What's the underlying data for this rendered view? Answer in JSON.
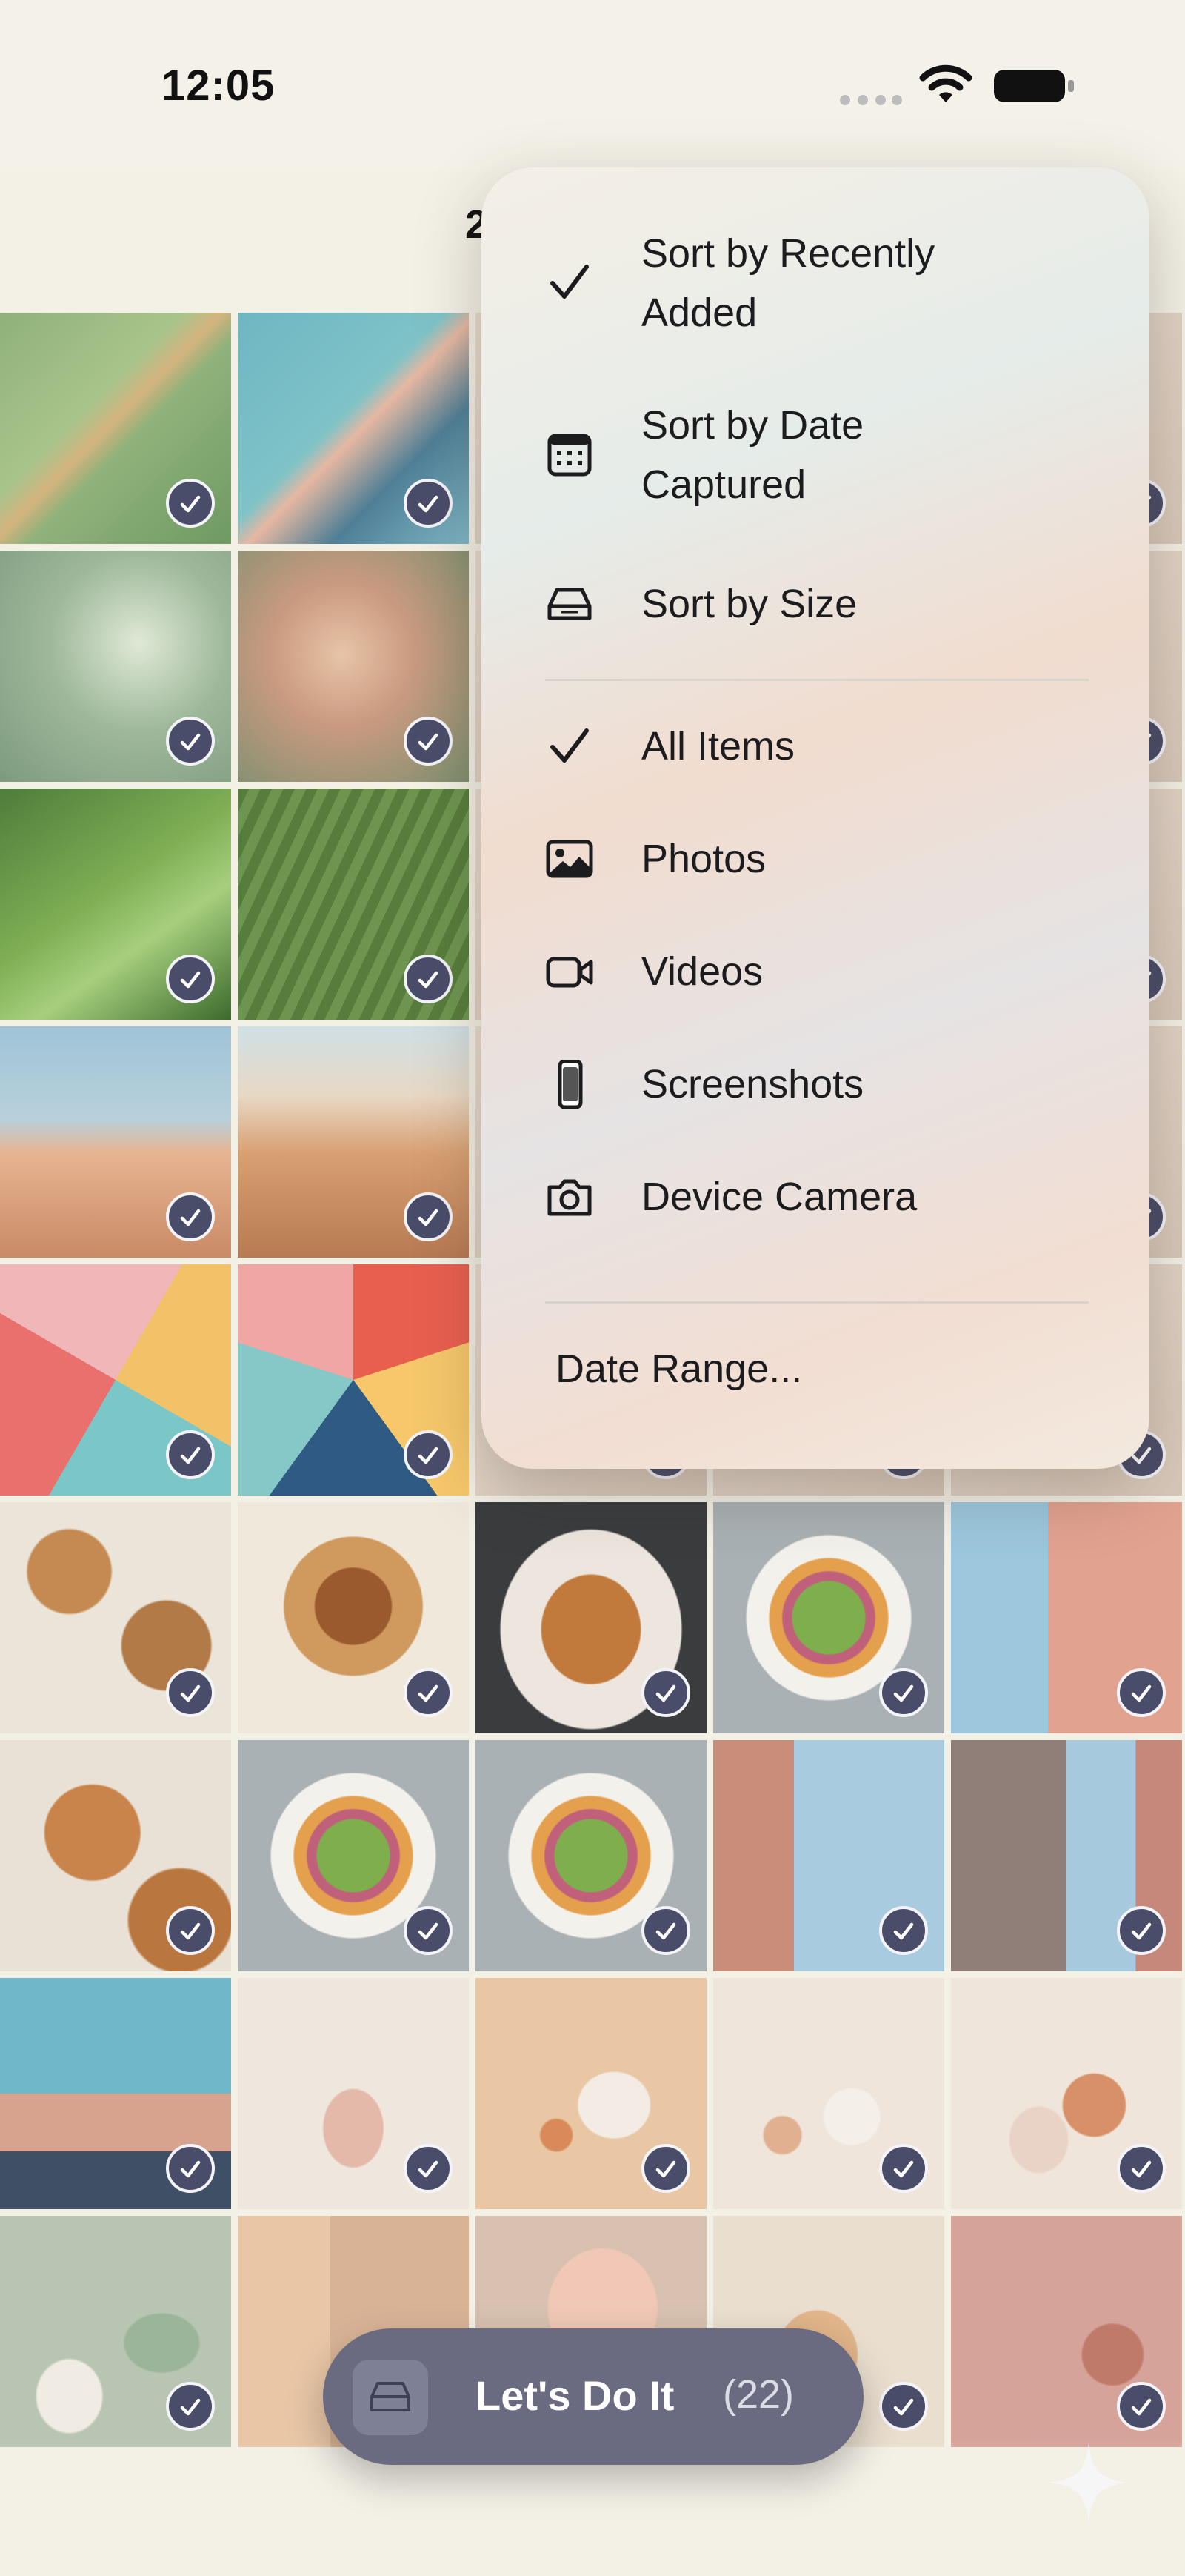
{
  "status_bar": {
    "time": "12:05"
  },
  "header": {
    "count_partial": "2"
  },
  "menu": {
    "sort_options": [
      {
        "label": "Sort by Recently Added",
        "icon": "checkmark-icon",
        "selected": true
      },
      {
        "label": "Sort by Date Captured",
        "icon": "calendar-icon",
        "selected": false
      },
      {
        "label": "Sort by Size",
        "icon": "disk-icon",
        "selected": false
      }
    ],
    "filter_options": [
      {
        "label": "All Items",
        "icon": "checkmark-icon",
        "selected": true
      },
      {
        "label": "Photos",
        "icon": "photo-icon",
        "selected": false
      },
      {
        "label": "Videos",
        "icon": "video-icon",
        "selected": false
      },
      {
        "label": "Screenshots",
        "icon": "phone-icon",
        "selected": false
      },
      {
        "label": "Device Camera",
        "icon": "camera-icon",
        "selected": false
      }
    ],
    "date_range_label": "Date Range..."
  },
  "grid": {
    "rows": 9,
    "cols": 5,
    "all_selected": true,
    "photos": [
      [
        "aerial-fields",
        "coastline-aerial",
        "",
        "",
        ""
      ],
      [
        "leaf-curl",
        "water-droplet",
        "",
        "",
        ""
      ],
      [
        "leaf-dew",
        "palm-leaf",
        "",
        "",
        ""
      ],
      [
        "sand-dunes",
        "desert-dunes",
        "",
        "",
        ""
      ],
      [
        "geometric-pastel",
        "geometric-tiles",
        "",
        "",
        ""
      ],
      [
        "cinnamon-rolls",
        "pastry-swirls",
        "croissant-plate",
        "salad-bowl",
        "pink-building"
      ],
      [
        "pinwheel-pastries",
        "salad-bowl",
        "salad-bowl",
        "city-buildings",
        "city-tower"
      ],
      [
        "roof-architecture",
        "vase-still-life",
        "vase-egg",
        "vase-sphere",
        "bowl-sphere"
      ],
      [
        "green-vase",
        "beige-shapes",
        "pink-fabric",
        "clay-arch",
        "pink-still-life"
      ]
    ]
  },
  "cta": {
    "label": "Let's Do It",
    "count": "(22)",
    "icon": "disk-icon"
  },
  "colors": {
    "accent": "#4a4d6a",
    "cta_bg": "#6a6b80",
    "background": "#f3f0e6"
  }
}
